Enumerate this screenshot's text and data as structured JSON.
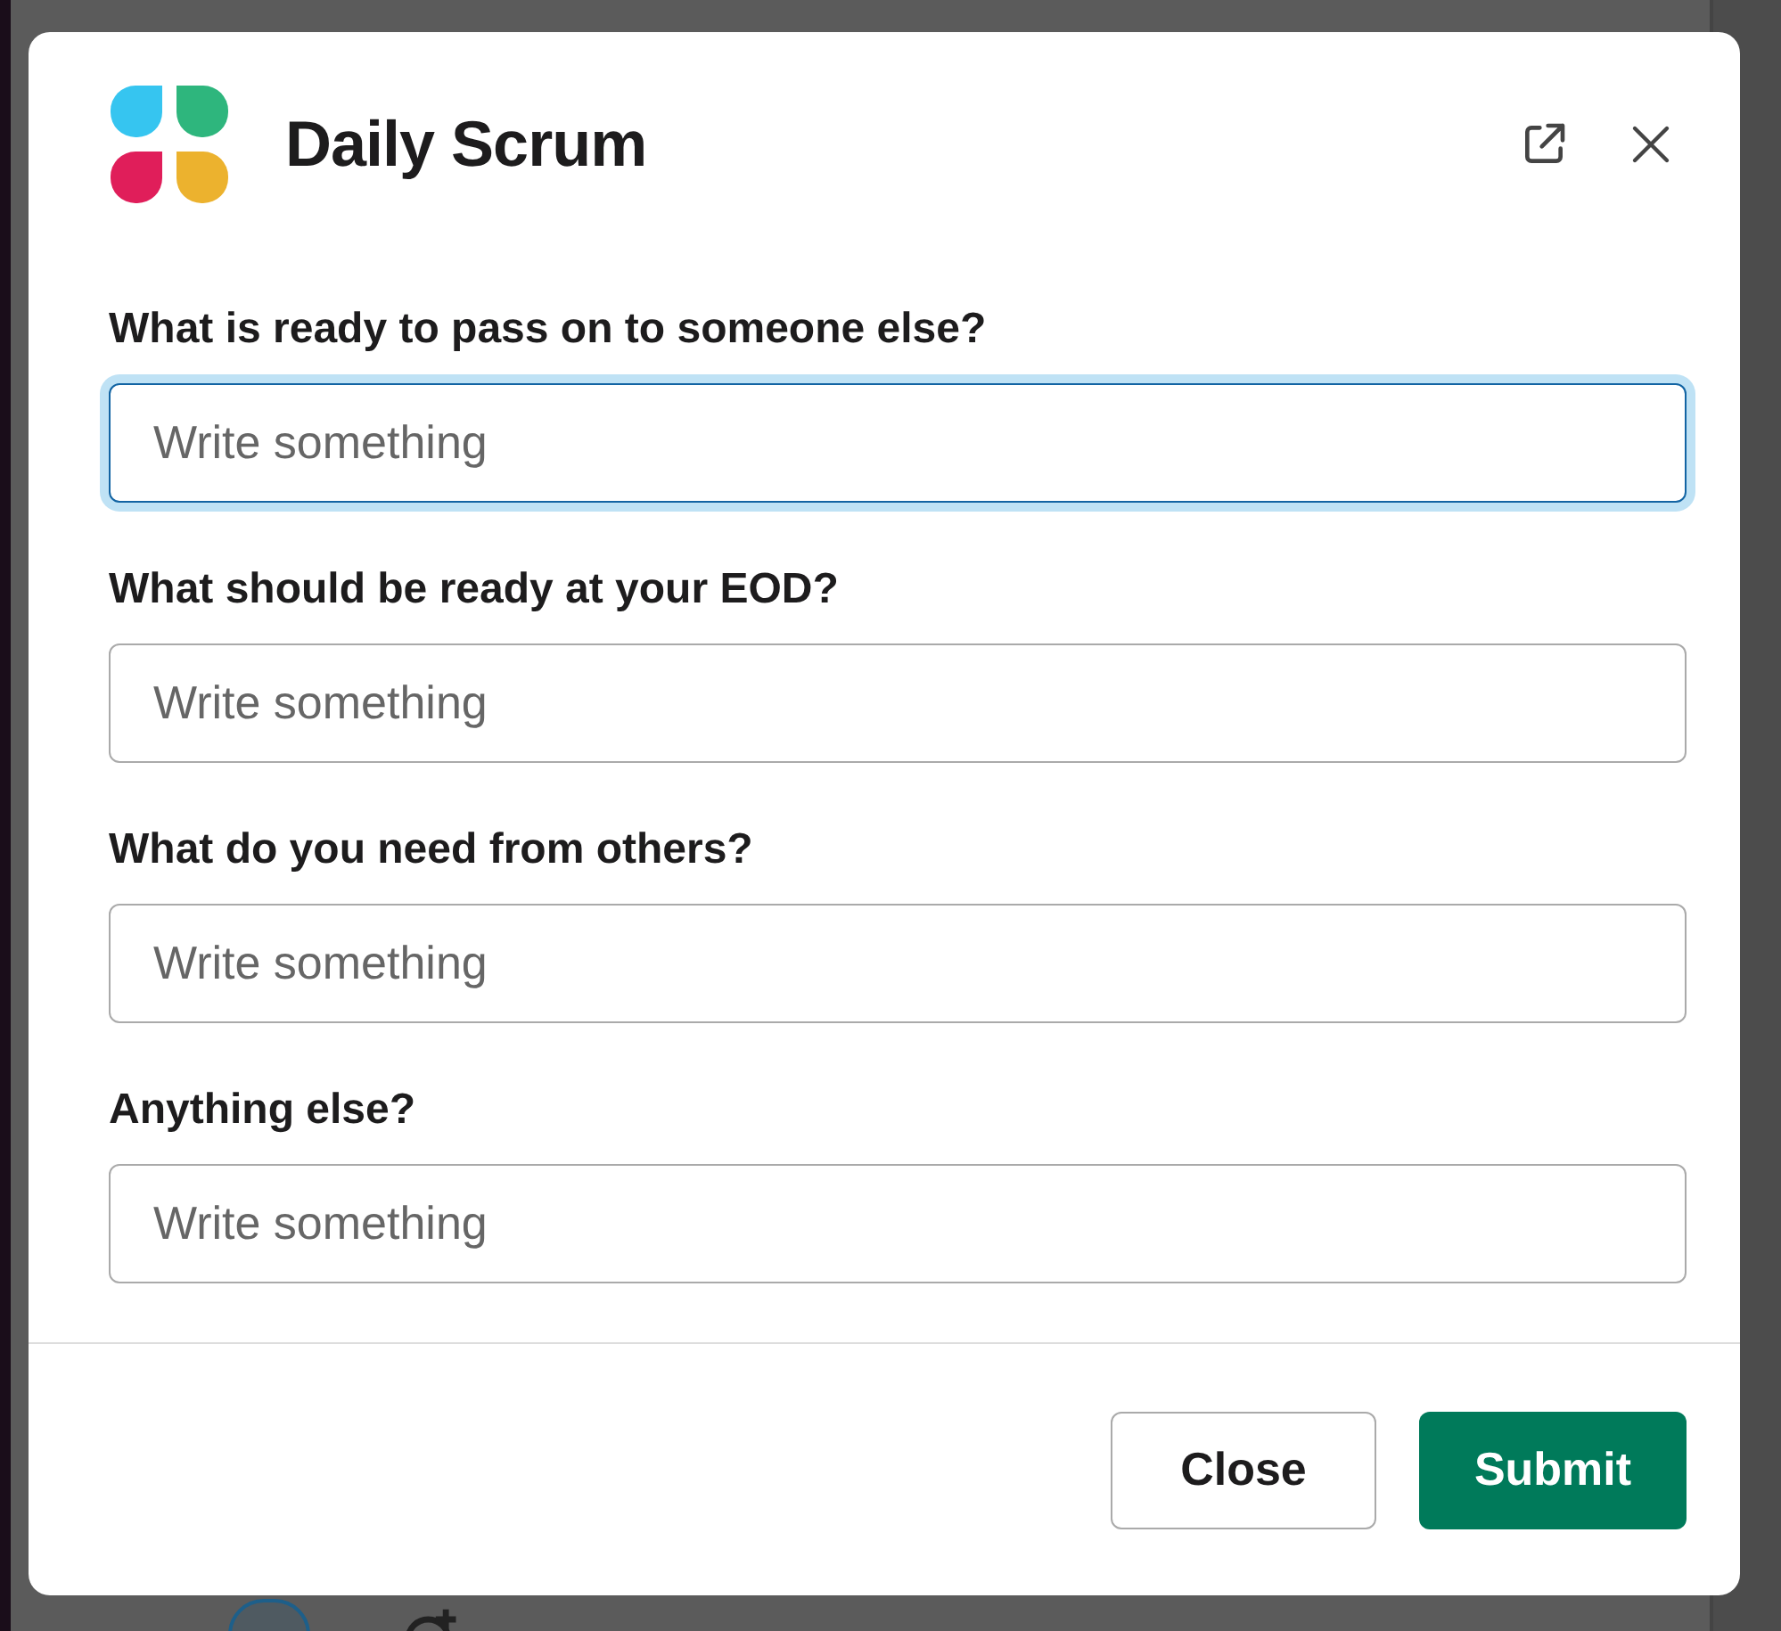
{
  "modal": {
    "title": "Daily Scrum",
    "fields": [
      {
        "label": "What is ready to pass on to someone else?",
        "placeholder": "Write something",
        "focused": true
      },
      {
        "label": "What should be ready at your EOD?",
        "placeholder": "Write something",
        "focused": false
      },
      {
        "label": "What do you need from others?",
        "placeholder": "Write something",
        "focused": false
      },
      {
        "label": "Anything else?",
        "placeholder": "Write something",
        "focused": false
      }
    ],
    "buttons": [
      {
        "label": "Close",
        "kind": "secondary"
      },
      {
        "label": "Submit",
        "kind": "primary"
      }
    ]
  }
}
